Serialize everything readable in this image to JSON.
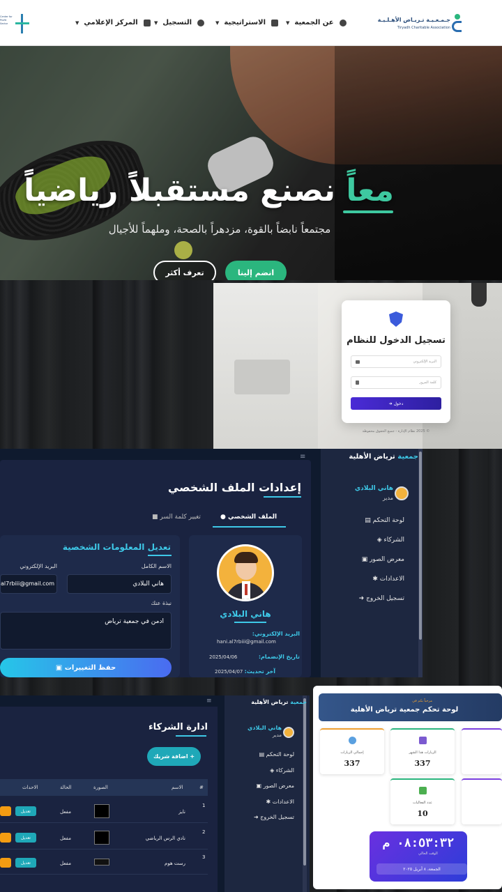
{
  "hero": {
    "brand_name_ar": "جـمـعـيـة تـريـاض الأهـلـيـة",
    "brand_name_en": "Tiryadh Charitable Association",
    "partner_logo_text": "Center for Profit Sector",
    "nav": [
      {
        "label": "عن الجمعية"
      },
      {
        "label": "الاستراتيجية"
      },
      {
        "label": "التسجيل"
      },
      {
        "label": "المركز الإعلامي"
      }
    ],
    "title_accent": "معاً",
    "title_rest": "نصنع مستقبلاً رياضياً",
    "subtitle": "مجتمعاً نابضاً بالقوة، مزدهراً بالصحة، وملهماً للأجيال",
    "join_button": "انضم إلينا",
    "more_button": "تعرف أكثر"
  },
  "login": {
    "title": "تسجيل الدخول للنظام",
    "email_placeholder": "البريد الإلكتروني",
    "password_placeholder": "كلمة المرور",
    "submit": "دخول",
    "footer": "© 2025 نظام الإدارة - جميع الحقوق محفوظة"
  },
  "sidebar": {
    "brand_accent": "جمعية",
    "brand_rest": "ترياض الأهلية",
    "user_name": "هاني البلادي",
    "user_role": "مدير",
    "items": [
      {
        "label": "لوحة التحكم"
      },
      {
        "label": "الشركاء"
      },
      {
        "label": "معرض الصور"
      },
      {
        "label": "الاعدادات"
      },
      {
        "label": "تسجيل الخروج"
      }
    ]
  },
  "profile": {
    "page_title": "إعدادات الملف الشخصي",
    "tab_profile": "الملف الشخصي",
    "tab_password": "تغيير كلمة السر",
    "card_name": "هاني البلادي",
    "email_label": "البريد الإلكتروني:",
    "email_value": "hani.al7rbiii@gmail.com",
    "joined_label": "تاريخ الإنضمام:",
    "joined_value": "2025/04/06",
    "updated_label": "آخر تحديث:",
    "updated_value": "2025/04/07",
    "form_title": "تعديل المعلومات الشخصية",
    "fullname_label": "الاسم الكامل",
    "fullname_value": "هاني البلادي",
    "email_field_label": "البريد الإلكتروني",
    "email_field_value": "al7rbiii@gmail.com",
    "bio_label": "نبذة عنك",
    "bio_value": "ادمن في جمعية ترياض",
    "save_button": "حفظ التغييرات"
  },
  "partners": {
    "title": "ادارة الشركاء",
    "add_button": "+ اضافة شريك",
    "columns": [
      "#",
      "الاسم",
      "الصورة",
      "الحالة",
      "الاحداث"
    ],
    "rows": [
      {
        "num": "1",
        "name": "نايز",
        "status": "مفعل",
        "edit": "تعديل"
      },
      {
        "num": "2",
        "name": "نادي الرس الرياضي",
        "status": "مفعل",
        "edit": "تعديل"
      },
      {
        "num": "3",
        "name": "رست هوم",
        "status": "مفعل",
        "edit": "تعديل"
      }
    ]
  },
  "dashboard": {
    "greeting": "مرحباً بكم في",
    "title": "لوحة تحكم جمعية ترياض الأهلية",
    "stats": [
      {
        "label": "إجمالي الزيارات",
        "value": "337",
        "icon": "globe-icon",
        "color": "#f0a030"
      },
      {
        "label": "الزيارات هذا الشهر",
        "value": "337",
        "icon": "chart-icon",
        "color": "#2bb67e"
      },
      {
        "label": "عدد الفعاليات",
        "value": "10",
        "icon": "image-icon",
        "color": "#2bb67e"
      }
    ],
    "clock_time": "٠٨:٥٣:٣٢ م",
    "clock_label": "الوقت الحالي",
    "clock_date": "الجمعة، ٨ أبريل ٢٠٢٥"
  }
}
